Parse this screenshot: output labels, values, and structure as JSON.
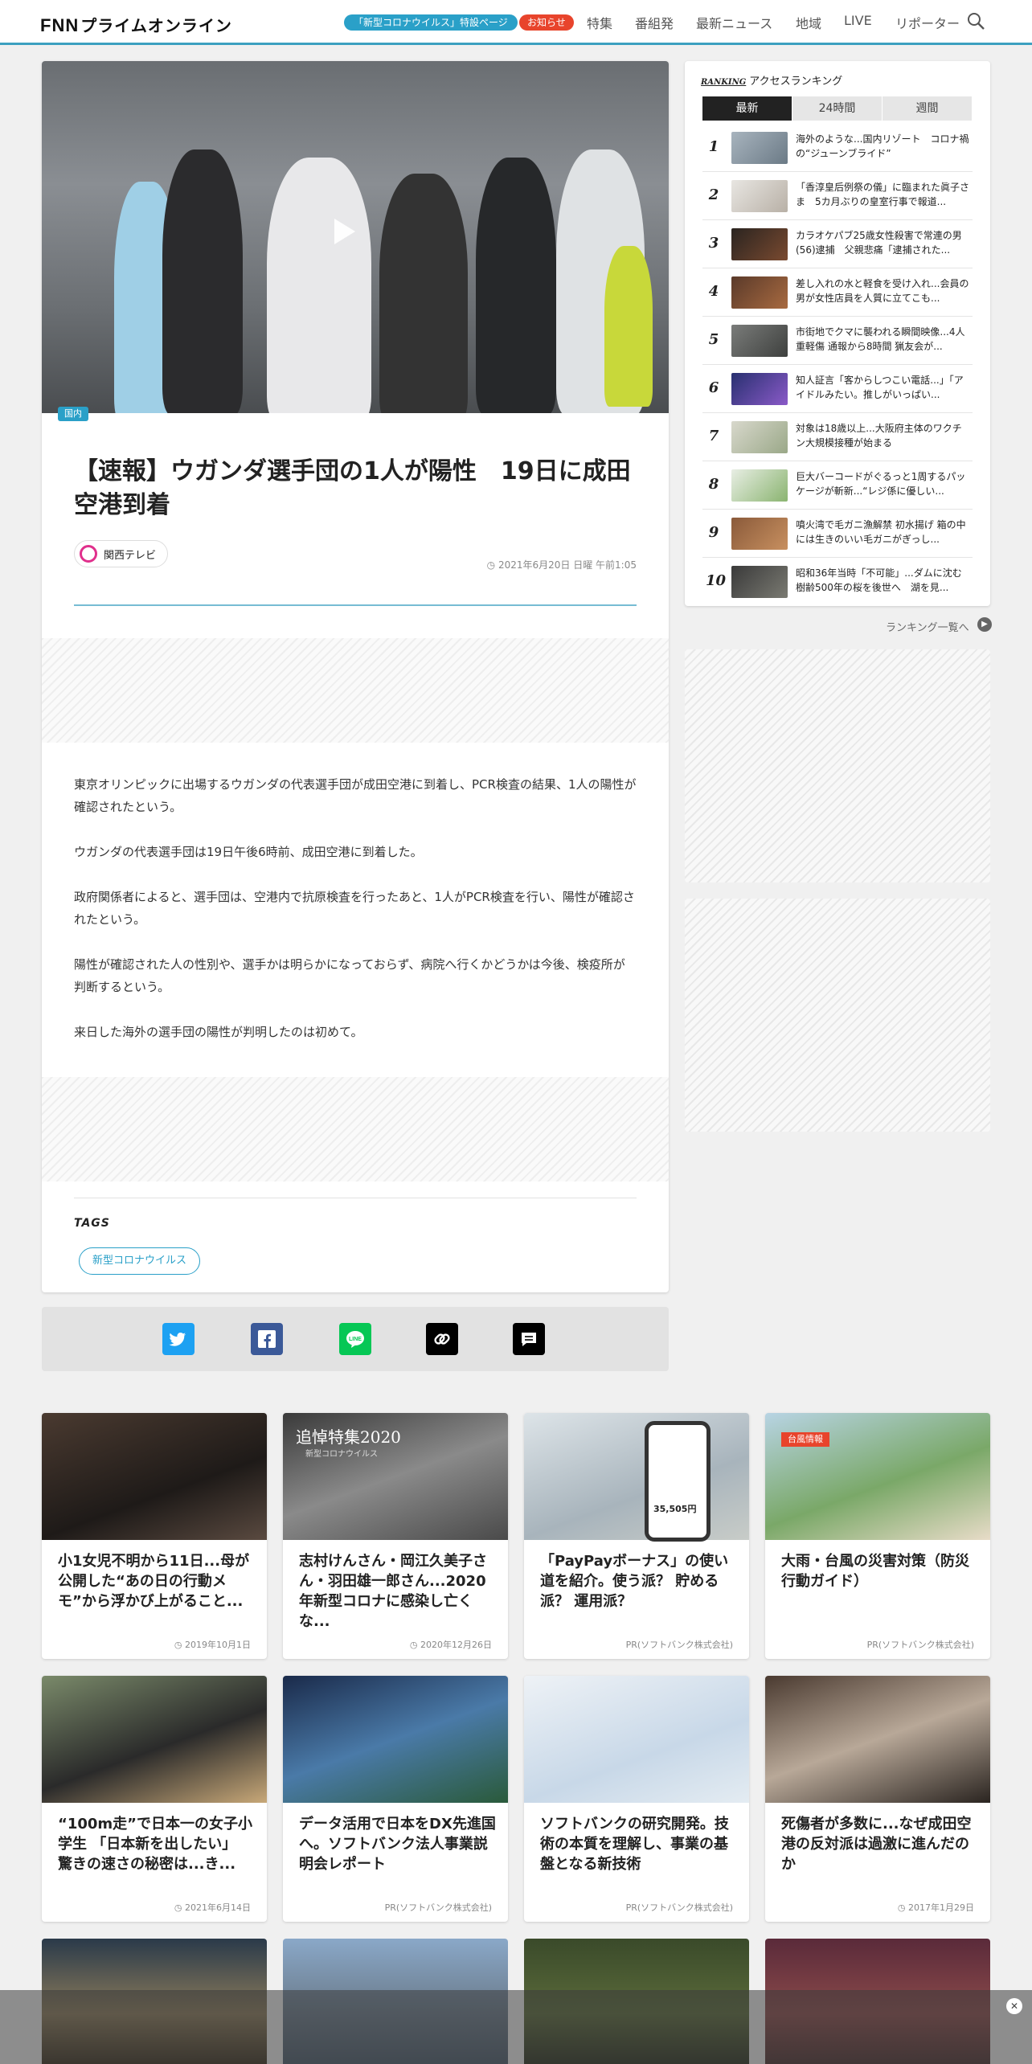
{
  "header": {
    "logo_prefix": "FNN",
    "logo_text": "プライムオンライン",
    "corona_pill": "「新型コロナウイルス」特設ページ",
    "news_pill": "お知らせ",
    "nav": [
      "特集",
      "番組発",
      "最新ニュース",
      "地域",
      "LIVE",
      "リポーター"
    ]
  },
  "article": {
    "category": "国内",
    "title": "【速報】ウガンダ選手団の1人が陽性　19日に成田空港到着",
    "source": "関西テレビ",
    "date": "2021年6月20日 日曜 午前1:05",
    "paragraphs": [
      "東京オリンピックに出場するウガンダの代表選手団が成田空港に到着し、PCR検査の結果、1人の陽性が確認されたという。",
      "ウガンダの代表選手団は19日午後6時前、成田空港に到着した。",
      "政府関係者によると、選手団は、空港内で抗原検査を行ったあと、1人がPCR検査を行い、陽性が確認されたという。",
      "陽性が確認された人の性別や、選手かは明らかになっておらず、病院へ行くかどうかは今後、検疫所が判断するという。",
      "来日した海外の選手団の陽性が判明したのは初めて。"
    ],
    "tags_label": "TAGS",
    "tags": [
      "新型コロナウイルス"
    ]
  },
  "share": {
    "buttons": [
      {
        "name": "twitter-share-button",
        "glyph": "t",
        "color": "#1da1f2"
      },
      {
        "name": "facebook-share-button",
        "glyph": "f",
        "color": "#3b5998"
      },
      {
        "name": "line-share-button",
        "glyph": "LINE",
        "color": "#06c755"
      },
      {
        "name": "copy-link-button",
        "glyph": "⚭",
        "color": "#000000"
      },
      {
        "name": "comment-button",
        "glyph": "▤",
        "color": "#000000"
      }
    ]
  },
  "ranking": {
    "label_r": "RANKING",
    "label": "アクセスランキング",
    "tabs": [
      "最新",
      "24時間",
      "週間"
    ],
    "items": [
      {
        "rank": "1",
        "text": "海外のような...国内リゾート　コロナ禍の“ジューンブライド”"
      },
      {
        "rank": "2",
        "text": "「香淳皇后例祭の儀」に臨まれた眞子さま　5カ月ぶりの皇室行事で報道..."
      },
      {
        "rank": "3",
        "text": "カラオケパブ25歳女性殺害で常連の男(56)逮捕　父親悲痛「逮捕された..."
      },
      {
        "rank": "4",
        "text": "差し入れの水と軽食を受け入れ...会員の男が女性店員を人質に立てこも..."
      },
      {
        "rank": "5",
        "text": "市街地でクマに襲われる瞬間映像...4人重軽傷 通報から8時間 猟友会が..."
      },
      {
        "rank": "6",
        "text": "知人証言「客からしつこい電話...」「アイドルみたい。推しがいっぱい..."
      },
      {
        "rank": "7",
        "text": "対象は18歳以上...大阪府主体のワクチン大規模接種が始まる"
      },
      {
        "rank": "8",
        "text": "巨大バーコードがぐるっと1周するパッケージが斬新...“レジ係に優しい..."
      },
      {
        "rank": "9",
        "text": "噴火湾で毛ガニ漁解禁 初水揚げ 箱の中には生きのいい毛ガニがぎっし..."
      },
      {
        "rank": "10",
        "text": "昭和36年当時「不可能」...ダムに沈む樹齢500年の桜を後世へ　湖を見..."
      }
    ],
    "more": "ランキング一覧へ"
  },
  "grid": [
    {
      "title": "小1女児不明から11日...母が公開した“あの日の行動メモ”から浮かび上がること...",
      "meta": "2019年10月1日",
      "clock": true
    },
    {
      "title": "志村けんさん・岡江久美子さん・羽田雄一郎さん...2020年新型コロナに感染し亡くな...",
      "meta": "2020年12月26日",
      "clock": true
    },
    {
      "title": "「PayPayボーナス」の使い道を紹介。使う派？ 貯める派？ 運用派？",
      "meta": "PR(ソフトバンク株式会社)",
      "clock": false
    },
    {
      "title": "大雨・台風の災害対策（防災行動ガイド）",
      "meta": "PR(ソフトバンク株式会社)",
      "clock": false
    },
    {
      "title": "“100m走”で日本一の女子小学生 「日本新を出したい」 驚きの速さの秘密は...き...",
      "meta": "2021年6月14日",
      "clock": true
    },
    {
      "title": "データ活用で日本をDX先進国へ。ソフトバンク法人事業説明会レポート",
      "meta": "PR(ソフトバンク株式会社)",
      "clock": false
    },
    {
      "title": "ソフトバンクの研究開発。技術の本質を理解し、事業の基盤となる新技術",
      "meta": "PR(ソフトバンク株式会社)",
      "clock": false
    },
    {
      "title": "死傷者が多数に...なぜ成田空港の反対派は過激に進んだのか",
      "meta": "2017年1月29日",
      "clock": true
    }
  ],
  "thumb_text": {
    "memorial_title": "追悼特集2020",
    "memorial_sub": "新型コロナウイルス",
    "typhoon_label": "台風情報",
    "pay_amount": "35,505円"
  },
  "colors": {
    "accent": "#2aa0c8",
    "news_red": "#e8442c"
  }
}
